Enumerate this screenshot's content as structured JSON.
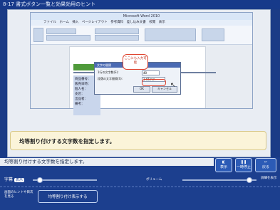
{
  "title": "8-17 書式ボタン一覧と効果効用のヒント",
  "word": {
    "window_title": "Microsoft Word 2010",
    "tabs": "ファイル　ホーム　挿入　ページレイアウト　参考資料　差し込み文書　校閲　表示",
    "doc_lines": [
      "商品番号：",
      "販売日時：",
      "個人名：",
      "支店：",
      "出品者：",
      "備考："
    ]
  },
  "dialog": {
    "title": "文字の間隔",
    "row1_label": "1行の文字数(E):",
    "row1_value": "40",
    "row2_label": "段落の文字間隔(S):",
    "row2_value": "1.65mm",
    "ok": "OK",
    "cancel": "キャンセル"
  },
  "callout": {
    "text": "ここにも入力可能"
  },
  "instruction": "均等割り付けする文字数を指定します。",
  "subtitle": "均等割り付けする文字数を指定します。",
  "controls": [
    {
      "label": "表示"
    },
    {
      "label": "一時停止"
    },
    {
      "label": "戻る"
    }
  ],
  "sound": {
    "label": "字幕",
    "tag": "表示",
    "volume_label": "ボリューム",
    "right_label": "詳細を表示"
  },
  "bottom": {
    "left_text": "画面のヒントや目次を見る",
    "nav_button": "均等割り付け表示する"
  },
  "colors": {
    "accent": "#1c3f8e",
    "highlight": "#e0442f",
    "yellow": "#fbf4d9"
  },
  "progress": {
    "audio_fraction": 0.12,
    "volume_fraction": 0.95
  }
}
